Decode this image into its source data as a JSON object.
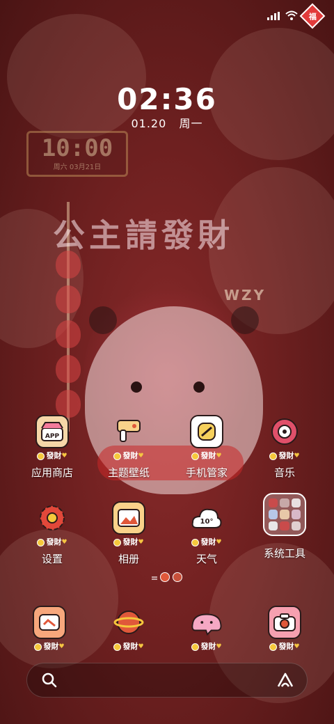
{
  "status_bar": {
    "signal_icon": "signal-icon",
    "wifi_icon": "wifi-icon",
    "badge_text": "福"
  },
  "clock": {
    "time": "02:36",
    "date": "01.20",
    "weekday": "周一"
  },
  "wallpaper": {
    "stamp_time": "10:00",
    "stamp_date": "周六 03月21日",
    "headline": "公主請發財",
    "tag": "WZY"
  },
  "apps": [
    {
      "label": "应用商店",
      "badge": "發財",
      "icon": "app-store-icon"
    },
    {
      "label": "主题壁纸",
      "badge": "發財",
      "icon": "theme-wallpaper-icon"
    },
    {
      "label": "手机管家",
      "badge": "發財",
      "icon": "phone-manager-icon"
    },
    {
      "label": "音乐",
      "badge": "發財",
      "icon": "music-icon"
    },
    {
      "label": "设置",
      "badge": "發財",
      "icon": "settings-icon"
    },
    {
      "label": "相册",
      "badge": "發財",
      "icon": "gallery-icon"
    },
    {
      "label": "天气",
      "badge": "發財",
      "icon": "weather-icon",
      "temp": "10°"
    },
    {
      "label": "系统工具",
      "icon": "folder-icon"
    }
  ],
  "dock": [
    {
      "badge": "發財",
      "icon": "dock-app-1-icon"
    },
    {
      "badge": "發財",
      "icon": "dock-app-2-icon"
    },
    {
      "badge": "發財",
      "icon": "dock-app-3-icon"
    },
    {
      "badge": "發財",
      "icon": "camera-icon"
    }
  ],
  "colors": {
    "background": "#6e2020",
    "accent": "#f6c83c",
    "badge_red": "#e23b3b"
  }
}
